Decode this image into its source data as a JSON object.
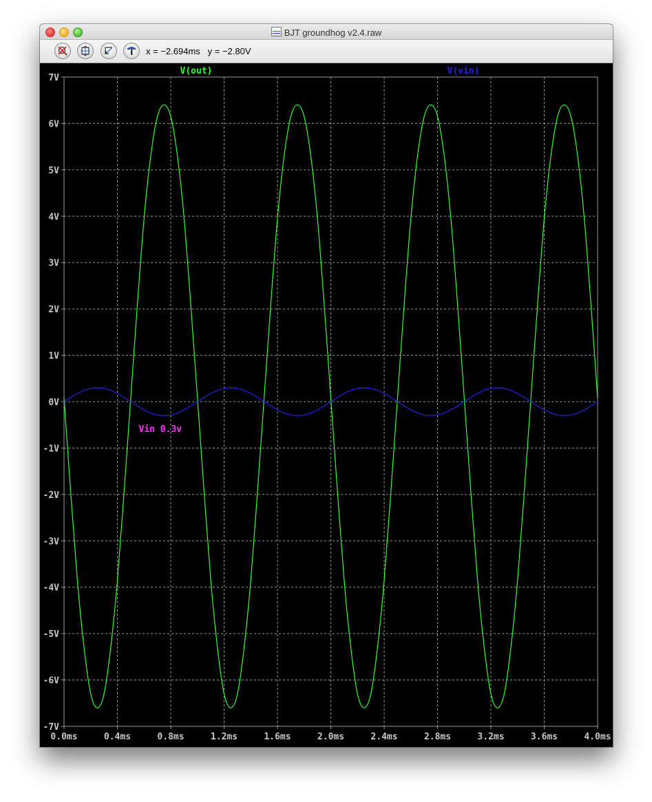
{
  "window": {
    "title": "BJT groundhog v2.4.raw"
  },
  "toolbar": {
    "tools": [
      "zoom-cancel-icon",
      "zoom-extents-icon",
      "zoom-back-icon",
      "probe-icon"
    ],
    "x_readout": "x = −2.694ms",
    "y_readout": "y = −2.80V"
  },
  "colors": {
    "plot_background": "#000000",
    "grid": "#9a9a9a",
    "axis_text": "#c8c8c8",
    "vout": "#33ff33",
    "vin": "#2323e6",
    "annotation": "#ff33ff"
  },
  "chart_data": {
    "type": "line",
    "grid": true,
    "xlim": [
      0,
      4.0
    ],
    "ylim": [
      -7,
      7
    ],
    "x_tick_labels": [
      "0.0ms",
      "0.4ms",
      "0.8ms",
      "1.2ms",
      "1.6ms",
      "2.0ms",
      "2.4ms",
      "2.8ms",
      "3.2ms",
      "3.6ms",
      "4.0ms"
    ],
    "y_tick_labels": [
      "7V",
      "6V",
      "5V",
      "4V",
      "3V",
      "2V",
      "1V",
      "0V",
      "-1V",
      "-2V",
      "-3V",
      "-4V",
      "-5V",
      "-6V",
      "-7V"
    ],
    "series": [
      {
        "name": "V(out)",
        "color": "#33ff33",
        "x": [
          0.0,
          0.05,
          0.1,
          0.15,
          0.2,
          0.25,
          0.3,
          0.35,
          0.4,
          0.45,
          0.5,
          0.55,
          0.6,
          0.65,
          0.7,
          0.75,
          0.8,
          0.85,
          0.9,
          0.95,
          1.0,
          1.05,
          1.1,
          1.15,
          1.2,
          1.25,
          1.3,
          1.35,
          1.4,
          1.45,
          1.5,
          1.55,
          1.6,
          1.65,
          1.7,
          1.75,
          1.8,
          1.85,
          1.9,
          1.95,
          2.0,
          2.05,
          2.1,
          2.15,
          2.2,
          2.25,
          2.3,
          2.35,
          2.4,
          2.45,
          2.5,
          2.55,
          2.6,
          2.65,
          2.7,
          2.75,
          2.8,
          2.85,
          2.9,
          2.95,
          3.0,
          3.05,
          3.1,
          3.15,
          3.2,
          3.25,
          3.3,
          3.35,
          3.4,
          3.45,
          3.5,
          3.55,
          3.6,
          3.65,
          3.7,
          3.75,
          3.8,
          3.85,
          3.9,
          3.95,
          4.0
        ],
        "y": [
          0.08,
          -1.95,
          -3.85,
          -5.3,
          -6.3,
          -6.6,
          -6.3,
          -5.3,
          -3.85,
          -1.95,
          0.08,
          2.1,
          3.95,
          5.3,
          6.15,
          6.4,
          6.15,
          5.3,
          3.95,
          2.1,
          0.08,
          -1.95,
          -3.85,
          -5.3,
          -6.3,
          -6.6,
          -6.3,
          -5.3,
          -3.85,
          -1.95,
          0.08,
          2.1,
          3.95,
          5.3,
          6.15,
          6.4,
          6.15,
          5.3,
          3.95,
          2.1,
          0.08,
          -1.95,
          -3.85,
          -5.3,
          -6.3,
          -6.6,
          -6.3,
          -5.3,
          -3.85,
          -1.95,
          0.08,
          2.1,
          3.95,
          5.3,
          6.15,
          6.4,
          6.15,
          5.3,
          3.95,
          2.1,
          0.08,
          -1.95,
          -3.85,
          -5.3,
          -6.3,
          -6.6,
          -6.3,
          -5.3,
          -3.85,
          -1.95,
          0.08,
          2.1,
          3.95,
          5.3,
          6.15,
          6.4,
          6.15,
          5.3,
          3.95,
          2.1,
          0.08
        ]
      },
      {
        "name": "V(vin)",
        "color": "#2323e6",
        "x": [
          0.0,
          0.05,
          0.1,
          0.15,
          0.2,
          0.25,
          0.3,
          0.35,
          0.4,
          0.45,
          0.5,
          0.55,
          0.6,
          0.65,
          0.7,
          0.75,
          0.8,
          0.85,
          0.9,
          0.95,
          1.0,
          1.05,
          1.1,
          1.15,
          1.2,
          1.25,
          1.3,
          1.35,
          1.4,
          1.45,
          1.5,
          1.55,
          1.6,
          1.65,
          1.7,
          1.75,
          1.8,
          1.85,
          1.9,
          1.95,
          2.0,
          2.05,
          2.1,
          2.15,
          2.2,
          2.25,
          2.3,
          2.35,
          2.4,
          2.45,
          2.5,
          2.55,
          2.6,
          2.65,
          2.7,
          2.75,
          2.8,
          2.85,
          2.9,
          2.95,
          3.0,
          3.05,
          3.1,
          3.15,
          3.2,
          3.25,
          3.3,
          3.35,
          3.4,
          3.45,
          3.5,
          3.55,
          3.6,
          3.65,
          3.7,
          3.75,
          3.8,
          3.85,
          3.9,
          3.95,
          4.0
        ],
        "y": [
          0,
          0.093,
          0.176,
          0.243,
          0.285,
          0.3,
          0.285,
          0.243,
          0.176,
          0.093,
          0,
          -0.093,
          -0.176,
          -0.243,
          -0.285,
          -0.3,
          -0.285,
          -0.243,
          -0.176,
          -0.093,
          0,
          0.093,
          0.176,
          0.243,
          0.285,
          0.3,
          0.285,
          0.243,
          0.176,
          0.093,
          0,
          -0.093,
          -0.176,
          -0.243,
          -0.285,
          -0.3,
          -0.285,
          -0.243,
          -0.176,
          -0.093,
          0,
          0.093,
          0.176,
          0.243,
          0.285,
          0.3,
          0.285,
          0.243,
          0.176,
          0.093,
          0,
          -0.093,
          -0.176,
          -0.243,
          -0.285,
          -0.3,
          -0.285,
          -0.243,
          -0.176,
          -0.093,
          0,
          0.093,
          0.176,
          0.243,
          0.285,
          0.3,
          0.285,
          0.243,
          0.176,
          0.093,
          0,
          -0.093,
          -0.176,
          -0.243,
          -0.285,
          -0.3,
          -0.285,
          -0.243,
          -0.176,
          -0.093,
          0
        ]
      }
    ],
    "annotations": [
      {
        "text": "Vin 0.3v",
        "x": 0.56,
        "y": -0.65,
        "color": "#ff33ff"
      }
    ]
  }
}
